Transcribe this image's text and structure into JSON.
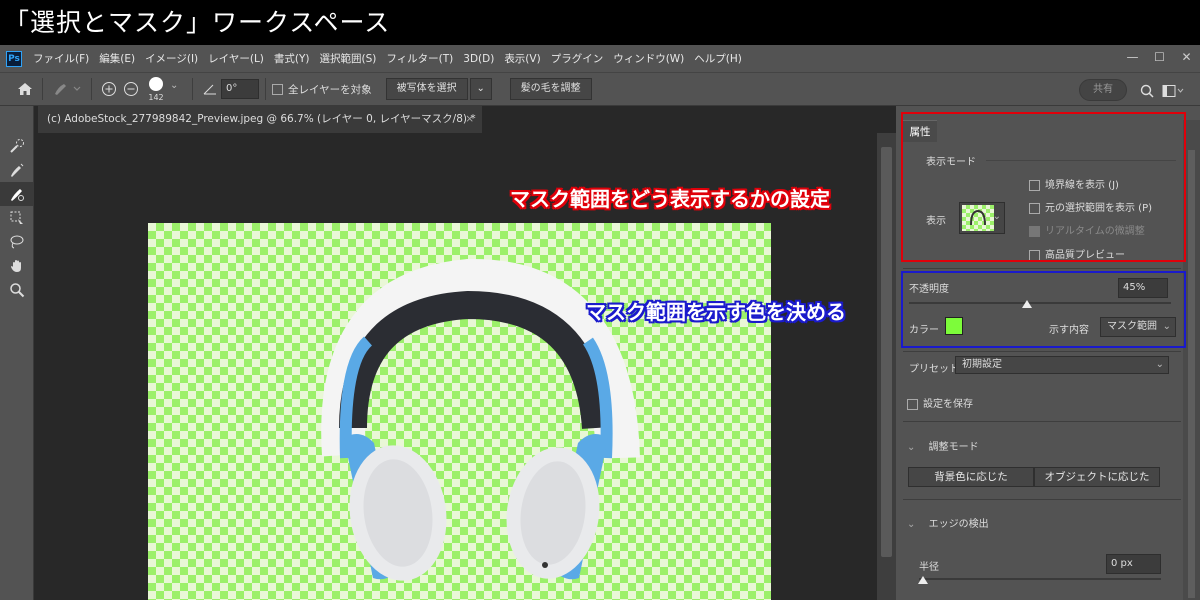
{
  "title_bar": {
    "text": "「選択とマスク」ワークスペース"
  },
  "menu": {
    "app_icon": "Ps",
    "items": [
      "ファイル(F)",
      "編集(E)",
      "イメージ(I)",
      "レイヤー(L)",
      "書式(Y)",
      "選択範囲(S)",
      "フィルター(T)",
      "3D(D)",
      "表示(V)",
      "プラグイン",
      "ウィンドウ(W)",
      "ヘルプ(H)"
    ],
    "window_controls": [
      "—",
      "☐",
      "✕"
    ]
  },
  "options": {
    "brush_size": "142",
    "angle_value": "0°",
    "sample_all_layers": "全レイヤーを対象",
    "select_subject": "被写体を選択",
    "refine_hair": "髪の毛を調整",
    "share": "共有"
  },
  "document": {
    "tab_title": "(c) AdobeStock_277989842_Preview.jpeg @ 66.7% (レイヤー 0, レイヤーマスク/8) *",
    "tab_close": "×"
  },
  "properties": {
    "panel_tab": "属性",
    "view_mode": {
      "title": "表示モード",
      "view_label": "表示",
      "show_edge": "境界線を表示 (J)",
      "show_original": "元の選択範囲を表示 (P)",
      "realtime": "リアルタイムの微調整",
      "hq_preview": "高品質プレビュー"
    },
    "opacity": {
      "label": "不透明度",
      "value": "45%",
      "level": 0.45
    },
    "color": {
      "label": "カラー",
      "swatch": "#7dfc3a"
    },
    "indicates": {
      "label": "示す内容",
      "value": "マスク範囲"
    },
    "preset": {
      "label": "プリセット",
      "value": "初期設定"
    },
    "remember": "設定を保存",
    "refine_mode": {
      "title": "調整モード",
      "option_a": "背景色に応じた",
      "option_b": "オブジェクトに応じた"
    },
    "edge_detection": {
      "title": "エッジの検出",
      "radius_label": "半径",
      "radius_value": "0 px"
    }
  },
  "annotations": {
    "red": {
      "text": "マスク範囲をどう表示するかの設定",
      "color": "#e0000a"
    },
    "blue": {
      "text": "マスク範囲を示す色を決める",
      "color": "#1a1acc"
    }
  },
  "colors": {
    "accent_green": "#7dfc3a",
    "checker_green": "#9cf06a"
  }
}
